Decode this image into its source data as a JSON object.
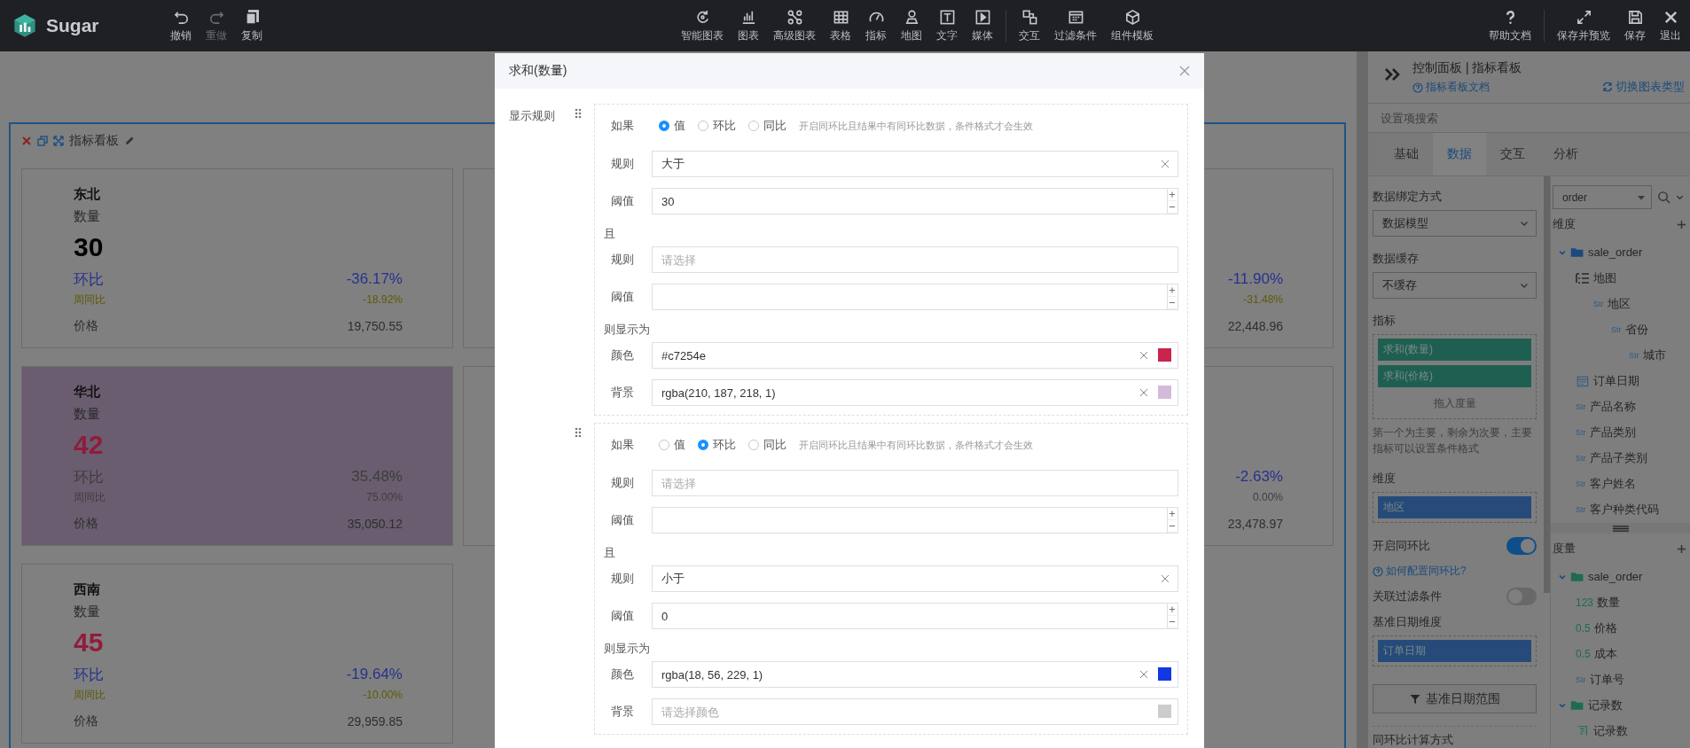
{
  "topbar": {
    "logo": "Sugar",
    "edit_tools": [
      {
        "label": "撤销",
        "kind": "undo",
        "disabled": false
      },
      {
        "label": "重做",
        "kind": "redo",
        "disabled": true
      },
      {
        "label": "复制",
        "kind": "copy",
        "disabled": false
      }
    ],
    "component_groups": [
      {
        "items": [
          {
            "label": "智能图表",
            "kind": "smart"
          },
          {
            "label": "图表",
            "kind": "bars"
          },
          {
            "label": "高级图表",
            "kind": "nodes"
          },
          {
            "label": "表格",
            "kind": "table"
          },
          {
            "label": "指标",
            "kind": "gauge"
          },
          {
            "label": "地图",
            "kind": "pin"
          },
          {
            "label": "文字",
            "kind": "text"
          },
          {
            "label": "媒体",
            "kind": "media"
          }
        ]
      },
      {
        "items": [
          {
            "label": "交互",
            "kind": "link"
          },
          {
            "label": "过滤条件",
            "kind": "filter"
          },
          {
            "label": "组件模板",
            "kind": "cube"
          }
        ]
      }
    ],
    "action_groups": [
      {
        "items": [
          {
            "label": "帮助文档",
            "kind": "help"
          }
        ]
      },
      {
        "items": [
          {
            "label": "保存并预览",
            "kind": "expand"
          },
          {
            "label": "保存",
            "kind": "save"
          },
          {
            "label": "退出",
            "kind": "exit"
          }
        ]
      }
    ]
  },
  "dashboard": {
    "title": "指标看板",
    "columns": [
      {
        "cards": [
          {
            "region": "东北",
            "measure": "数量",
            "value": {
              "text": "30",
              "color": "#000000"
            },
            "fill": {
              "color": "#808080"
            },
            "ratios": [
              {
                "label": "环比",
                "value": "-36.17%",
                "color": "#26318e"
              },
              {
                "label": "周同比",
                "value": "-18.92%",
                "color": "#5c5a08"
              }
            ],
            "price": {
              "label": "价格",
              "value": "19,750.55"
            }
          },
          {
            "region": "华北",
            "measure": "数量",
            "value": {
              "text": "42",
              "color": "#901c3c"
            },
            "fill": {
              "color": "#6a5d6f"
            },
            "ratios": [
              {
                "label": "环比",
                "value": "35.48%",
                "color": "#3d3d3d"
              },
              {
                "label": "周同比",
                "value": "75.00%",
                "color": "#3d3d3d"
              }
            ],
            "price": {
              "label": "价格",
              "value": "35,050.12"
            }
          },
          {
            "region": "西南",
            "measure": "数量",
            "value": {
              "text": "45",
              "color": "#901c3c"
            },
            "fill": {
              "color": "#808080"
            },
            "ratios": [
              {
                "label": "环比",
                "value": "-19.64%",
                "color": "#26318e"
              },
              {
                "label": "周同比",
                "value": "-10.00%",
                "color": "#5c5a08"
              }
            ],
            "price": {
              "label": "价格",
              "value": "29,959.85"
            }
          }
        ]
      },
      {
        "cards": [
          {
            "fill": {
              "color": "#808080"
            },
            "ratios": [
              {
                "value": "-11.90%",
                "color": "#26318e"
              },
              {
                "value": "-31.48%",
                "color": "#5c5a08"
              }
            ],
            "price": {
              "value": "22,448.96"
            }
          },
          {
            "fill": {
              "color": "#808080"
            },
            "ratios": [
              {
                "value": "-2.63%",
                "color": "#26318e"
              },
              {
                "value": "0.00%",
                "color": "#3d3d3d"
              }
            ],
            "price": {
              "value": "23,478.97"
            }
          }
        ]
      }
    ]
  },
  "dialog": {
    "title": "求和(数量)",
    "section_label": "显示规则",
    "rules": [
      {
        "condition_label": "如果",
        "modes": [
          {
            "label": "值",
            "selected": true
          },
          {
            "label": "环比",
            "selected": false
          },
          {
            "label": "同比",
            "selected": false
          }
        ],
        "hint": "开启同环比且结果中有同环比数据，条件格式才会生效",
        "fields": [
          {
            "kind": "select",
            "label": "规则",
            "value": "大于"
          },
          {
            "kind": "number",
            "label": "阈值",
            "value": "30"
          },
          {
            "kind": "heading",
            "label": "且"
          },
          {
            "kind": "select",
            "label": "规则",
            "placeholder": "请选择"
          },
          {
            "kind": "number",
            "label": "阈值"
          },
          {
            "kind": "heading",
            "label": "则显示为"
          },
          {
            "kind": "color",
            "label": "颜色",
            "value": "#c7254e",
            "swatch": {
              "color": "#c7254e"
            }
          },
          {
            "kind": "color",
            "label": "背景",
            "value": "rgba(210, 187, 218, 1)",
            "swatch": {
              "color": "#d2bbda"
            }
          }
        ]
      },
      {
        "condition_label": "如果",
        "modes": [
          {
            "label": "值",
            "selected": false
          },
          {
            "label": "环比",
            "selected": true
          },
          {
            "label": "同比",
            "selected": false
          }
        ],
        "hint": "开启同环比且结果中有同环比数据，条件格式才会生效",
        "fields": [
          {
            "kind": "select",
            "label": "规则",
            "placeholder": "请选择"
          },
          {
            "kind": "number",
            "label": "阈值"
          },
          {
            "kind": "heading",
            "label": "且"
          },
          {
            "kind": "select",
            "label": "规则",
            "value": "小于"
          },
          {
            "kind": "number",
            "label": "阈值",
            "value": "0"
          },
          {
            "kind": "heading",
            "label": "则显示为"
          },
          {
            "kind": "color",
            "label": "颜色",
            "value": "rgba(18, 56, 229, 1)",
            "swatch": {
              "color": "#1238e5"
            }
          },
          {
            "kind": "color",
            "label": "背景",
            "placeholder": "请选择颜色",
            "swatch": {
              "color": "#cccccc"
            }
          }
        ]
      }
    ]
  },
  "panel": {
    "title": "控制面板 | 指标看板",
    "doc_link": "指标看板文档",
    "switch_link": "切换图表类型",
    "search": {
      "placeholder": "设置项搜索"
    },
    "tabs": [
      {
        "label": "基础",
        "selected": false
      },
      {
        "label": "数据",
        "selected": true
      },
      {
        "label": "交互",
        "selected": false
      },
      {
        "label": "分析",
        "selected": false
      }
    ],
    "settings": [
      {
        "kind": "select",
        "label": "数据绑定方式",
        "value": "数据模型"
      },
      {
        "kind": "select",
        "label": "数据缓存",
        "value": "不缓存"
      },
      {
        "kind": "drop",
        "label": "指标",
        "chips": [
          {
            "label": "求和(数量)",
            "color": "#1f5f52"
          },
          {
            "label": "求和(价格)",
            "color": "#1f5f52"
          }
        ],
        "placeholder": "拖入度量"
      },
      {
        "kind": "hint",
        "text": "第一个为主要，剩余为次要，主要指标可以设置条件格式"
      },
      {
        "kind": "drop",
        "label": "维度",
        "chips": [
          {
            "label": "地区",
            "color": "#264b7a"
          }
        ]
      },
      {
        "kind": "toggle",
        "label": "开启同环比",
        "on": true
      },
      {
        "kind": "link",
        "text": "如何配置同环比?"
      },
      {
        "kind": "toggle",
        "label": "关联过滤条件",
        "on": false
      },
      {
        "kind": "drop",
        "label": "基准日期维度",
        "chips": [
          {
            "label": "订单日期",
            "color": "#264b7a"
          }
        ]
      },
      {
        "kind": "button",
        "text": "基准日期范围"
      },
      {
        "kind": "heading",
        "text": "同环比计算方式"
      }
    ],
    "source": {
      "value": "order"
    },
    "dimensions": {
      "title": "维度",
      "tree": [
        {
          "label": "sale_order",
          "kind": "folder",
          "expanded": true,
          "children": [
            {
              "label": "地图",
              "kind": "hierarchy",
              "children": [
                {
                  "label": "地区",
                  "kind": "str",
                  "type": "Str",
                  "children": [
                    {
                      "label": "省份",
                      "kind": "str",
                      "type": "Str",
                      "children": [
                        {
                          "label": "城市",
                          "kind": "str",
                          "type": "Str"
                        }
                      ]
                    }
                  ]
                }
              ]
            },
            {
              "label": "订单日期",
              "kind": "date"
            },
            {
              "label": "产品名称",
              "kind": "str",
              "type": "Str"
            },
            {
              "label": "产品类别",
              "kind": "str",
              "type": "Str"
            },
            {
              "label": "产品子类别",
              "kind": "str",
              "type": "Str"
            },
            {
              "label": "客户姓名",
              "kind": "str",
              "type": "Str"
            },
            {
              "label": "客户种类代码",
              "kind": "str",
              "type": "Str"
            }
          ]
        }
      ]
    },
    "measures": {
      "title": "度量",
      "tree": [
        {
          "label": "sale_order",
          "kind": "folder",
          "expanded": true,
          "children": [
            {
              "label": "数量",
              "kind": "number",
              "type": "123"
            },
            {
              "label": "价格",
              "kind": "number",
              "type": "0.5"
            },
            {
              "label": "成本",
              "kind": "number",
              "type": "0.5"
            },
            {
              "label": "订单号",
              "kind": "str",
              "type": "Str"
            }
          ]
        },
        {
          "label": "记录数",
          "kind": "folder",
          "expanded": true,
          "children": [
            {
              "label": "记录数",
              "kind": "record"
            }
          ]
        }
      ]
    }
  }
}
